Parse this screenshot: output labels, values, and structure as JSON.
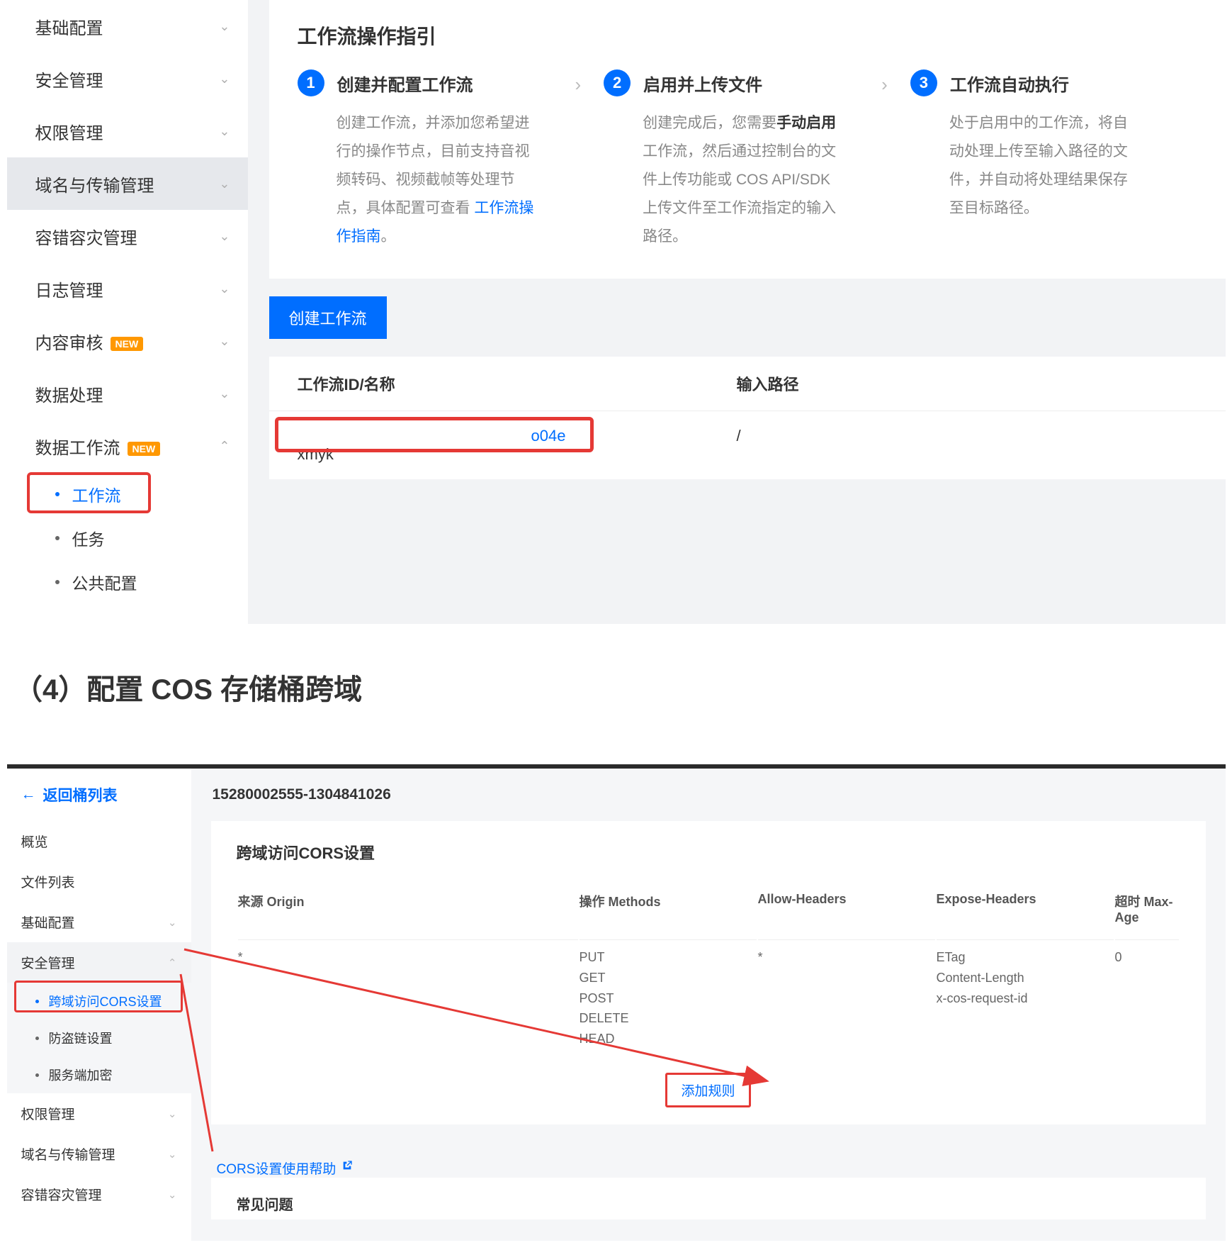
{
  "scr1": {
    "sidebar": {
      "items": [
        {
          "label": "基础配置",
          "chev": "down"
        },
        {
          "label": "安全管理",
          "chev": "down"
        },
        {
          "label": "权限管理",
          "chev": "down"
        },
        {
          "label": "域名与传输管理",
          "chev": "down",
          "active": true
        },
        {
          "label": "容错容灾管理",
          "chev": "down"
        },
        {
          "label": "日志管理",
          "chev": "down"
        },
        {
          "label": "内容审核",
          "chev": "down",
          "badge": "NEW"
        },
        {
          "label": "数据处理",
          "chev": "down"
        },
        {
          "label": "数据工作流",
          "chev": "up",
          "badge": "NEW"
        }
      ],
      "subitems": [
        {
          "label": "工作流",
          "active": true
        },
        {
          "label": "任务"
        },
        {
          "label": "公共配置"
        }
      ]
    },
    "guide": {
      "title": "工作流操作指引",
      "steps": [
        {
          "num": "1",
          "title": "创建并配置工作流",
          "desc": "创建工作流，并添加您希望进行的操作节点，目前支持音视频转码、视频截帧等处理节点，具体配置可查看 ",
          "link": "工作流操作指南",
          "tail": "。"
        },
        {
          "num": "2",
          "title": "启用并上传文件",
          "desc_pre": "创建完成后，您需要",
          "bold": "手动启用",
          "desc_post": "工作流，然后通过控制台的文件上传功能或 COS API/SDK 上传文件至工作流指定的输入路径。"
        },
        {
          "num": "3",
          "title": "工作流自动执行",
          "desc": "处于启用中的工作流，将自动处理上传至输入路径的文件，并自动将处理结果保存至目标路径。"
        }
      ],
      "sep": "›"
    },
    "create_btn": "创建工作流",
    "table": {
      "col1": "工作流ID/名称",
      "col2": "输入路径",
      "row": {
        "id_suffix": "o04e",
        "name": "xmyk",
        "path": "/"
      }
    }
  },
  "heading": "（4）配置 COS 存储桶跨域",
  "scr2": {
    "back": "返回桶列表",
    "sidebar": [
      {
        "label": "概览"
      },
      {
        "label": "文件列表"
      },
      {
        "label": "基础配置",
        "chev": "down"
      },
      {
        "label": "安全管理",
        "chev": "up",
        "expanded": true
      }
    ],
    "sidebar_subs": [
      {
        "label": "跨域访问CORS设置",
        "active": true
      },
      {
        "label": "防盗链设置"
      },
      {
        "label": "服务端加密"
      }
    ],
    "sidebar_tail": [
      {
        "label": "权限管理",
        "chev": "down"
      },
      {
        "label": "域名与传输管理",
        "chev": "down"
      },
      {
        "label": "容错容灾管理",
        "chev": "down"
      }
    ],
    "bucket_id": "15280002555-1304841026",
    "cors": {
      "title": "跨域访问CORS设置",
      "th": [
        "来源 Origin",
        "操作 Methods",
        "Allow-Headers",
        "Expose-Headers",
        "超时 Max-Age"
      ],
      "row": {
        "origin": "*",
        "methods": "PUT\nGET\nPOST\nDELETE\nHEAD",
        "allow": "*",
        "expose": "ETag\nContent-Length\nx-cos-request-id",
        "maxage": "0"
      },
      "add_rule": "添加规则",
      "help": "CORS设置使用帮助"
    },
    "bottom_card": "常见问题"
  }
}
